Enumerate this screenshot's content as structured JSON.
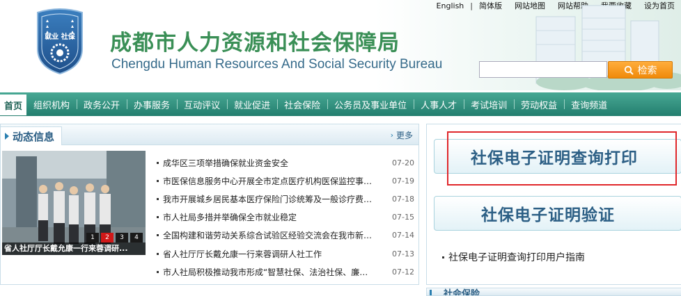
{
  "top_links": [
    "English",
    "简体版",
    "网站地图",
    "网站帮助",
    "我要收藏",
    "设为首页"
  ],
  "logo": {
    "text": "就业 社保"
  },
  "header": {
    "title": "成都市人力资源和社会保障局",
    "subtitle": "Chengdu Human Resources And Social Security Bureau"
  },
  "search": {
    "placeholder": "",
    "button_label": "检索"
  },
  "nav": [
    "首页",
    "组织机构",
    "政务公开",
    "办事服务",
    "互动评议",
    "就业促进",
    "社会保险",
    "公务员及事业单位",
    "人事人才",
    "考试培训",
    "劳动权益",
    "查询频道"
  ],
  "news": {
    "section_title": "动态信息",
    "more_label": "更多",
    "photo_caption": "省人社厅厅长戴允康一行来蓉调研...",
    "pager": [
      "1",
      "2",
      "3",
      "4"
    ],
    "active_page": 2,
    "items": [
      {
        "title": "成华区三项举措确保就业资金安全",
        "date": "07-20"
      },
      {
        "title": "市医保信息服务中心开展全市定点医疗机构医保监控事…",
        "date": "07-19"
      },
      {
        "title": "我市开展城乡居民基本医疗保险门诊统筹及一般诊疗费…",
        "date": "07-18"
      },
      {
        "title": "市人社局多措并举确保全市就业稳定",
        "date": "07-15"
      },
      {
        "title": "全国构建和谐劳动关系综合试验区经验交流会在我市新…",
        "date": "07-14"
      },
      {
        "title": "省人社厅厅长戴允康一行来蓉调研人社工作",
        "date": "07-13"
      },
      {
        "title": "市人社局积极推动我市形成“智慧社保、法治社保、廉…",
        "date": "07-12"
      }
    ]
  },
  "right_panel": {
    "query_print_label": "社保电子证明查询打印",
    "verify_label": "社保电子证明验证",
    "guide_label": "社保电子证明查询打印用户指南"
  },
  "bottom_strip": {
    "title": "社会保险"
  },
  "colors": {
    "nav_bg": "#2f8f7c",
    "title_green": "#3a8f56",
    "accent_blue": "#2c5f85",
    "search_orange": "#f49a1c",
    "highlight_red": "#e0262a"
  }
}
